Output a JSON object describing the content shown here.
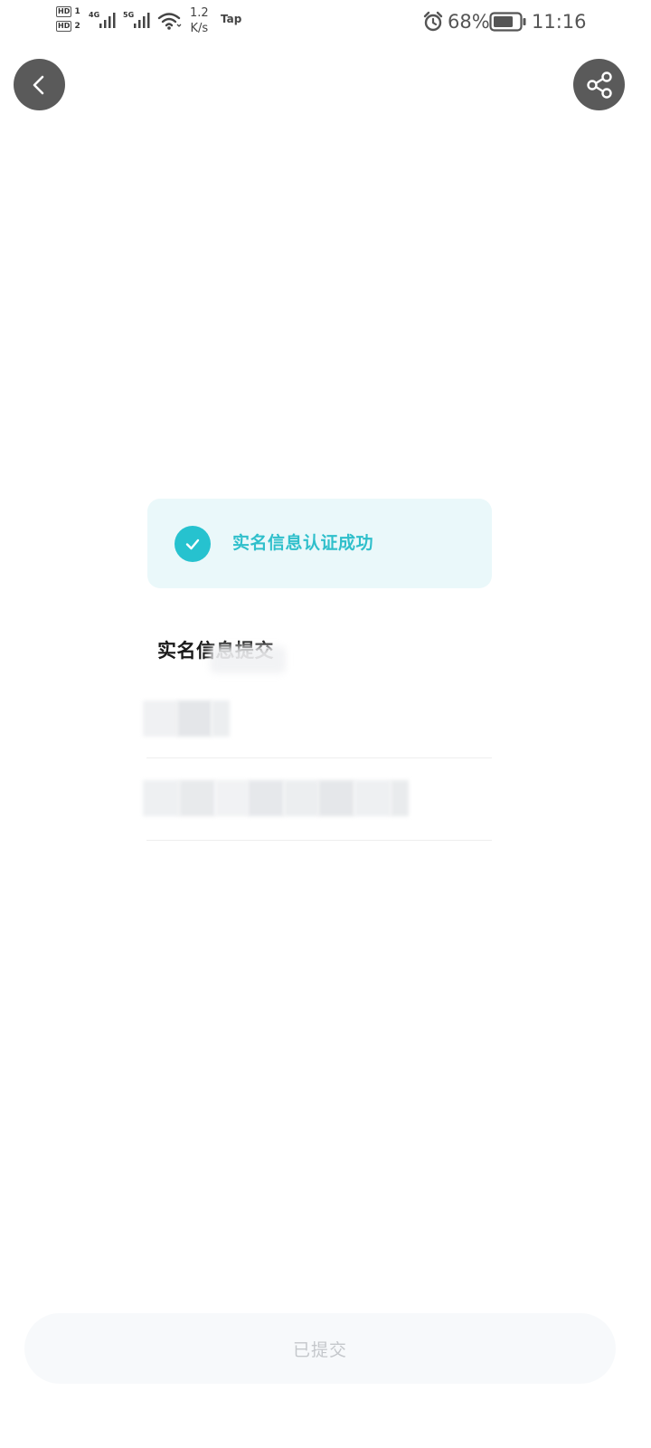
{
  "status_bar": {
    "hd1": "HD",
    "hd1_sim": "1",
    "hd2": "HD",
    "hd2_sim": "2",
    "net1": "4G",
    "net2": "5G",
    "speed_value": "1.2",
    "speed_unit": "K/s",
    "tap_label": "Tap",
    "battery_percent": "68%",
    "time": "11:16",
    "icons": [
      "alarm-icon",
      "battery-icon",
      "wifi-icon",
      "signal-icon"
    ]
  },
  "nav": {
    "back_icon": "chevron-left-icon",
    "share_icon": "share-icon"
  },
  "success_banner": {
    "text": "实名信息认证成功",
    "icon": "check-icon",
    "accent_color": "#26c2cf"
  },
  "submitted_info": {
    "title": "实名信息提交"
  },
  "footer": {
    "submit_label": "已提交"
  }
}
